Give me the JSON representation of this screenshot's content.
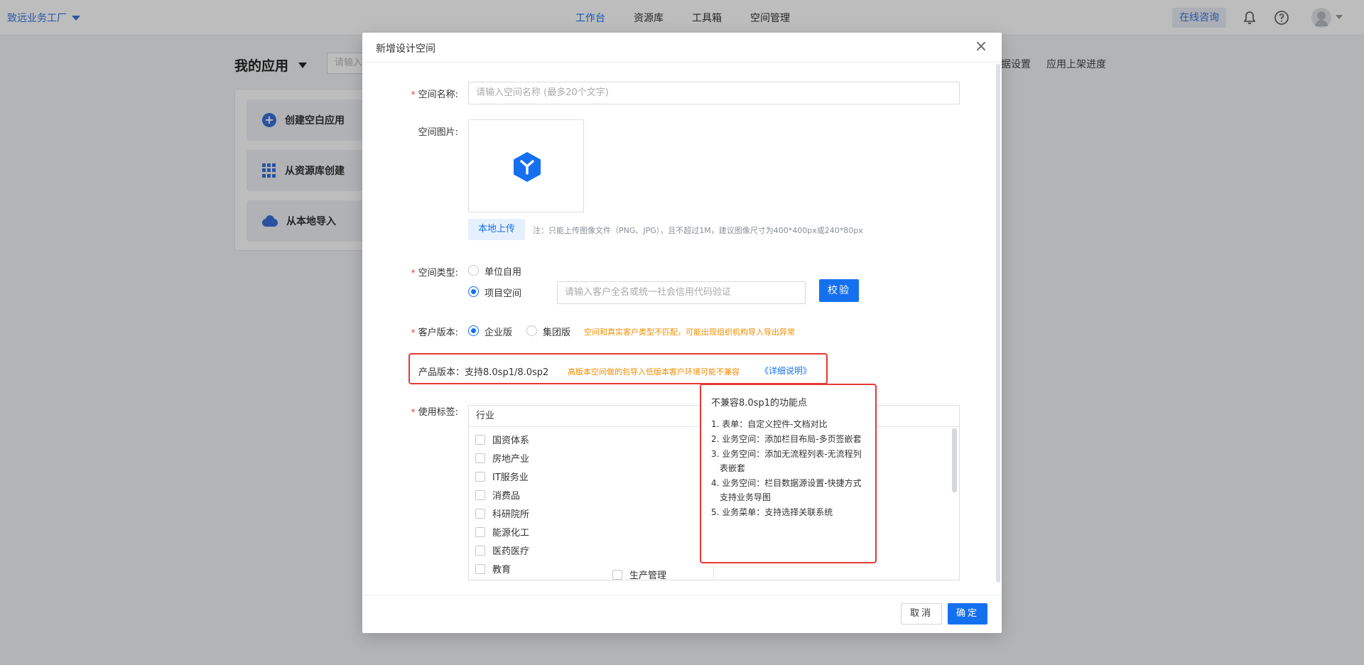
{
  "topbar": {
    "brand": "致远业务工厂",
    "nav": [
      "工作台",
      "资源库",
      "工具箱",
      "空间管理"
    ],
    "nav_active": 0,
    "consult": "在线咨询",
    "icons": [
      "bell-icon",
      "help-icon",
      "avatar-icon"
    ]
  },
  "page": {
    "title": "我的应用",
    "search_placeholder": "请输入",
    "links": [
      "数据设置",
      "应用上架进度"
    ],
    "actions": [
      "创建空白应用",
      "从资源库创建",
      "从本地导入"
    ]
  },
  "modal": {
    "title": "新增设计空间",
    "name_label": "空间名称:",
    "name_placeholder": "请输入空间名称 (最多20个文字)",
    "image_label": "空间图片:",
    "upload_label": "本地上传",
    "upload_note": "注：只能上传图像文件（PNG、JPG），且不超过1M，建议图像尺寸为400*400px或240*80px",
    "type_label": "空间类型:",
    "type_options": [
      "单位自用",
      "项目空间"
    ],
    "type_selected": 1,
    "customer_placeholder": "请输入客户全名或统一社会信用代码验证",
    "verify_label": "校验",
    "edition_label": "客户版本:",
    "edition_options": [
      "企业版",
      "集团版"
    ],
    "edition_selected": 0,
    "edition_warning": "空间和真实客户类型不匹配，可能出现组织机构导入导出异常",
    "product_text": "产品版本：支持8.0sp1/8.0sp2",
    "product_warning": "高版本空间做的包导入低版本客户环境可能不兼容",
    "product_link": "《详细说明》",
    "tags_label": "使用标签:",
    "tags_header": "行业",
    "industries": [
      "国资体系",
      "房地产业",
      "IT服务业",
      "消费品",
      "科研院所",
      "能源化工",
      "医药医疗",
      "教育"
    ],
    "right_col_partial": "生产管理",
    "tooltip_title": "不兼容8.0sp1的功能点",
    "tooltip_items": [
      "1. 表单：自定义控件-文档对比",
      "2. 业务空间：添加栏目布局-多页签嵌套",
      "3. 业务空间：添加无流程列表-无流程列表嵌套",
      "4. 业务空间：栏目数据源设置-快捷方式支持业务导图",
      "5. 业务菜单：支持选择关联系统"
    ],
    "cancel": "取消",
    "ok": "确定"
  },
  "colors": {
    "primary": "#1570ef",
    "warning": "#f08c00",
    "highlight": "#e53935"
  }
}
